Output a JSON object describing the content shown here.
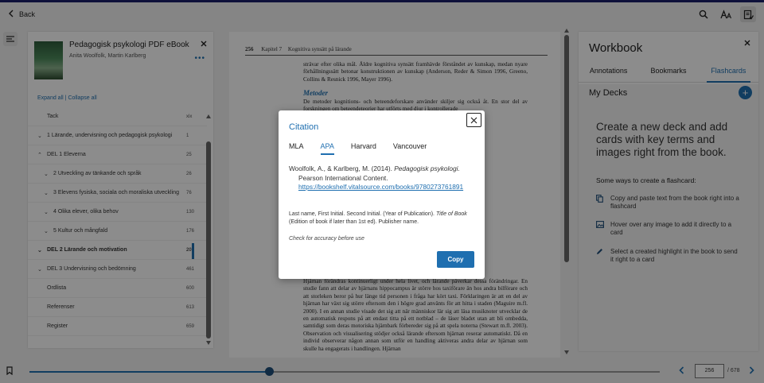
{
  "topbar": {
    "back_label": "Back",
    "icons": [
      "search-icon",
      "font-size-icon",
      "workbook-icon"
    ]
  },
  "toc": {
    "book_title": "Pedagogisk psykologi PDF eBook",
    "book_author": "Anita Woolfolk, Martin Karlberg",
    "expand_all": "Expand all",
    "collapse_all": "Collapse all",
    "separator": "|",
    "items": [
      {
        "label": "Tack",
        "page": "xix",
        "chevron": "",
        "level": "plain"
      },
      {
        "label": "1 Lärande, undervisning och pedagogisk psykologi",
        "page": "1",
        "chevron": "⌄",
        "level": "top"
      },
      {
        "label": "DEL 1 Eleverna",
        "page": "25",
        "chevron": "⌃",
        "level": "top"
      },
      {
        "label": "2 Utveckling av tänkande och språk",
        "page": "26",
        "chevron": "⌄",
        "level": "sub"
      },
      {
        "label": "3 Elevens fysiska, sociala och moraliska utveckling",
        "page": "76",
        "chevron": "⌄",
        "level": "sub"
      },
      {
        "label": "4 Olika elever, olika behov",
        "page": "130",
        "chevron": "⌄",
        "level": "sub"
      },
      {
        "label": "5 Kultur och mångfald",
        "page": "176",
        "chevron": "⌄",
        "level": "sub"
      },
      {
        "label": "DEL 2 Lärande och motivation",
        "page": "207",
        "chevron": "⌄",
        "level": "top",
        "current": true
      },
      {
        "label": "DEL 3 Undervisning och bedömning",
        "page": "461",
        "chevron": "⌄",
        "level": "top"
      },
      {
        "label": "Ordlista",
        "page": "600",
        "chevron": "",
        "level": "plain"
      },
      {
        "label": "Referenser",
        "page": "613",
        "chevron": "",
        "level": "plain"
      },
      {
        "label": "Register",
        "page": "659",
        "chevron": "",
        "level": "plain"
      }
    ]
  },
  "page": {
    "number": "256",
    "chapter": "Kapitel 7",
    "chapter_title": "Kognitiva synsätt på lärande",
    "para1": "strävar efter olika mål. Äldre kognitiva synsätt framhävde förståndet av kunskap, medan nyare förhållningssätt betonar konstruktionen av kunskap (Anderson, Reder & Simon 1996, Greeno, Collins & Resnick 1996, Mayer 1996).",
    "heading": "Metoder",
    "para2": "De metoder kognitions- och beteendeforskare använder skiljer sig också åt. En stor del av forskningen om beteendeteorier har utförts med djur i kontrollerade",
    "para3": "Hjärnan förändras kontinuerligt under hela livet, och lärande påverkar dessa förändringar. En studie fann att delar av hjärnans hippocampus är större hos taxiförare än hos andra bilförare och att storleken beror på hur länge tid personen i fråga har kört taxi. Förklaringen är att en del av hjärnan har växt sig större eftersom den i högre grad använts för att hitta i staden (Maguire m.fl. 2000). I en annan studie visade det sig att när människor lär sig att läsa musiknoter utvecklar de en automatisk respons på att endast titta på ett notblad – de läser bladet utan att bli ombedda, samtidigt som deras motoriska hjärnbark förbereder sig på att spela noterna (Stewart m.fl. 2003). Observation och visualisering stödjer också lärande eftersom hjärnan reserar automatiskt. Då en individ observerar någon annan som utför en handling aktiveras andra delar av hjärnan som skulle ha engagerats i handlingen. Hjärnan"
  },
  "workbook": {
    "title": "Workbook",
    "tabs": [
      "Annotations",
      "Bookmarks",
      "Flashcards"
    ],
    "active_tab": "Flashcards",
    "my_decks": "My Decks",
    "add_symbol": "+",
    "headline": "Create a new deck and add cards with key terms and images right from the book.",
    "ways_title": "Some ways to create a flashcard:",
    "tips": [
      {
        "icon": "copy-icon",
        "text": "Copy and paste text from the book right into a flashcard"
      },
      {
        "icon": "image-icon",
        "text": "Hover over any image to add it directly to a card"
      },
      {
        "icon": "pencil-icon",
        "text": "Select a created highlight in the book to send it right to a card"
      }
    ]
  },
  "navigation": {
    "current_page": "256",
    "total": "/ 678",
    "progress": 0.38
  },
  "modal": {
    "title": "Citation",
    "tabs": [
      "MLA",
      "APA",
      "Harvard",
      "Vancouver"
    ],
    "active_tab": "APA",
    "cite_authors": "Woolfolk, A., & Karlberg, M. (2014). ",
    "cite_title": "Pedagogisk psykologi.",
    "cite_publisher": "Pearson International Content.",
    "cite_url": "https://bookshelf.vitalsource.com/books/9780273761891",
    "format_part1": "Last name, First Initial. Second Initial. (Year of Publication). ",
    "format_title": "Title of Book",
    "format_part2": " (Edition of book if later than 1st ed). Publisher name.",
    "check": "Check for accuracy before use",
    "copy_label": "Copy"
  },
  "colors": {
    "accent": "#1f6fb0",
    "topline": "#1b1f6b"
  }
}
